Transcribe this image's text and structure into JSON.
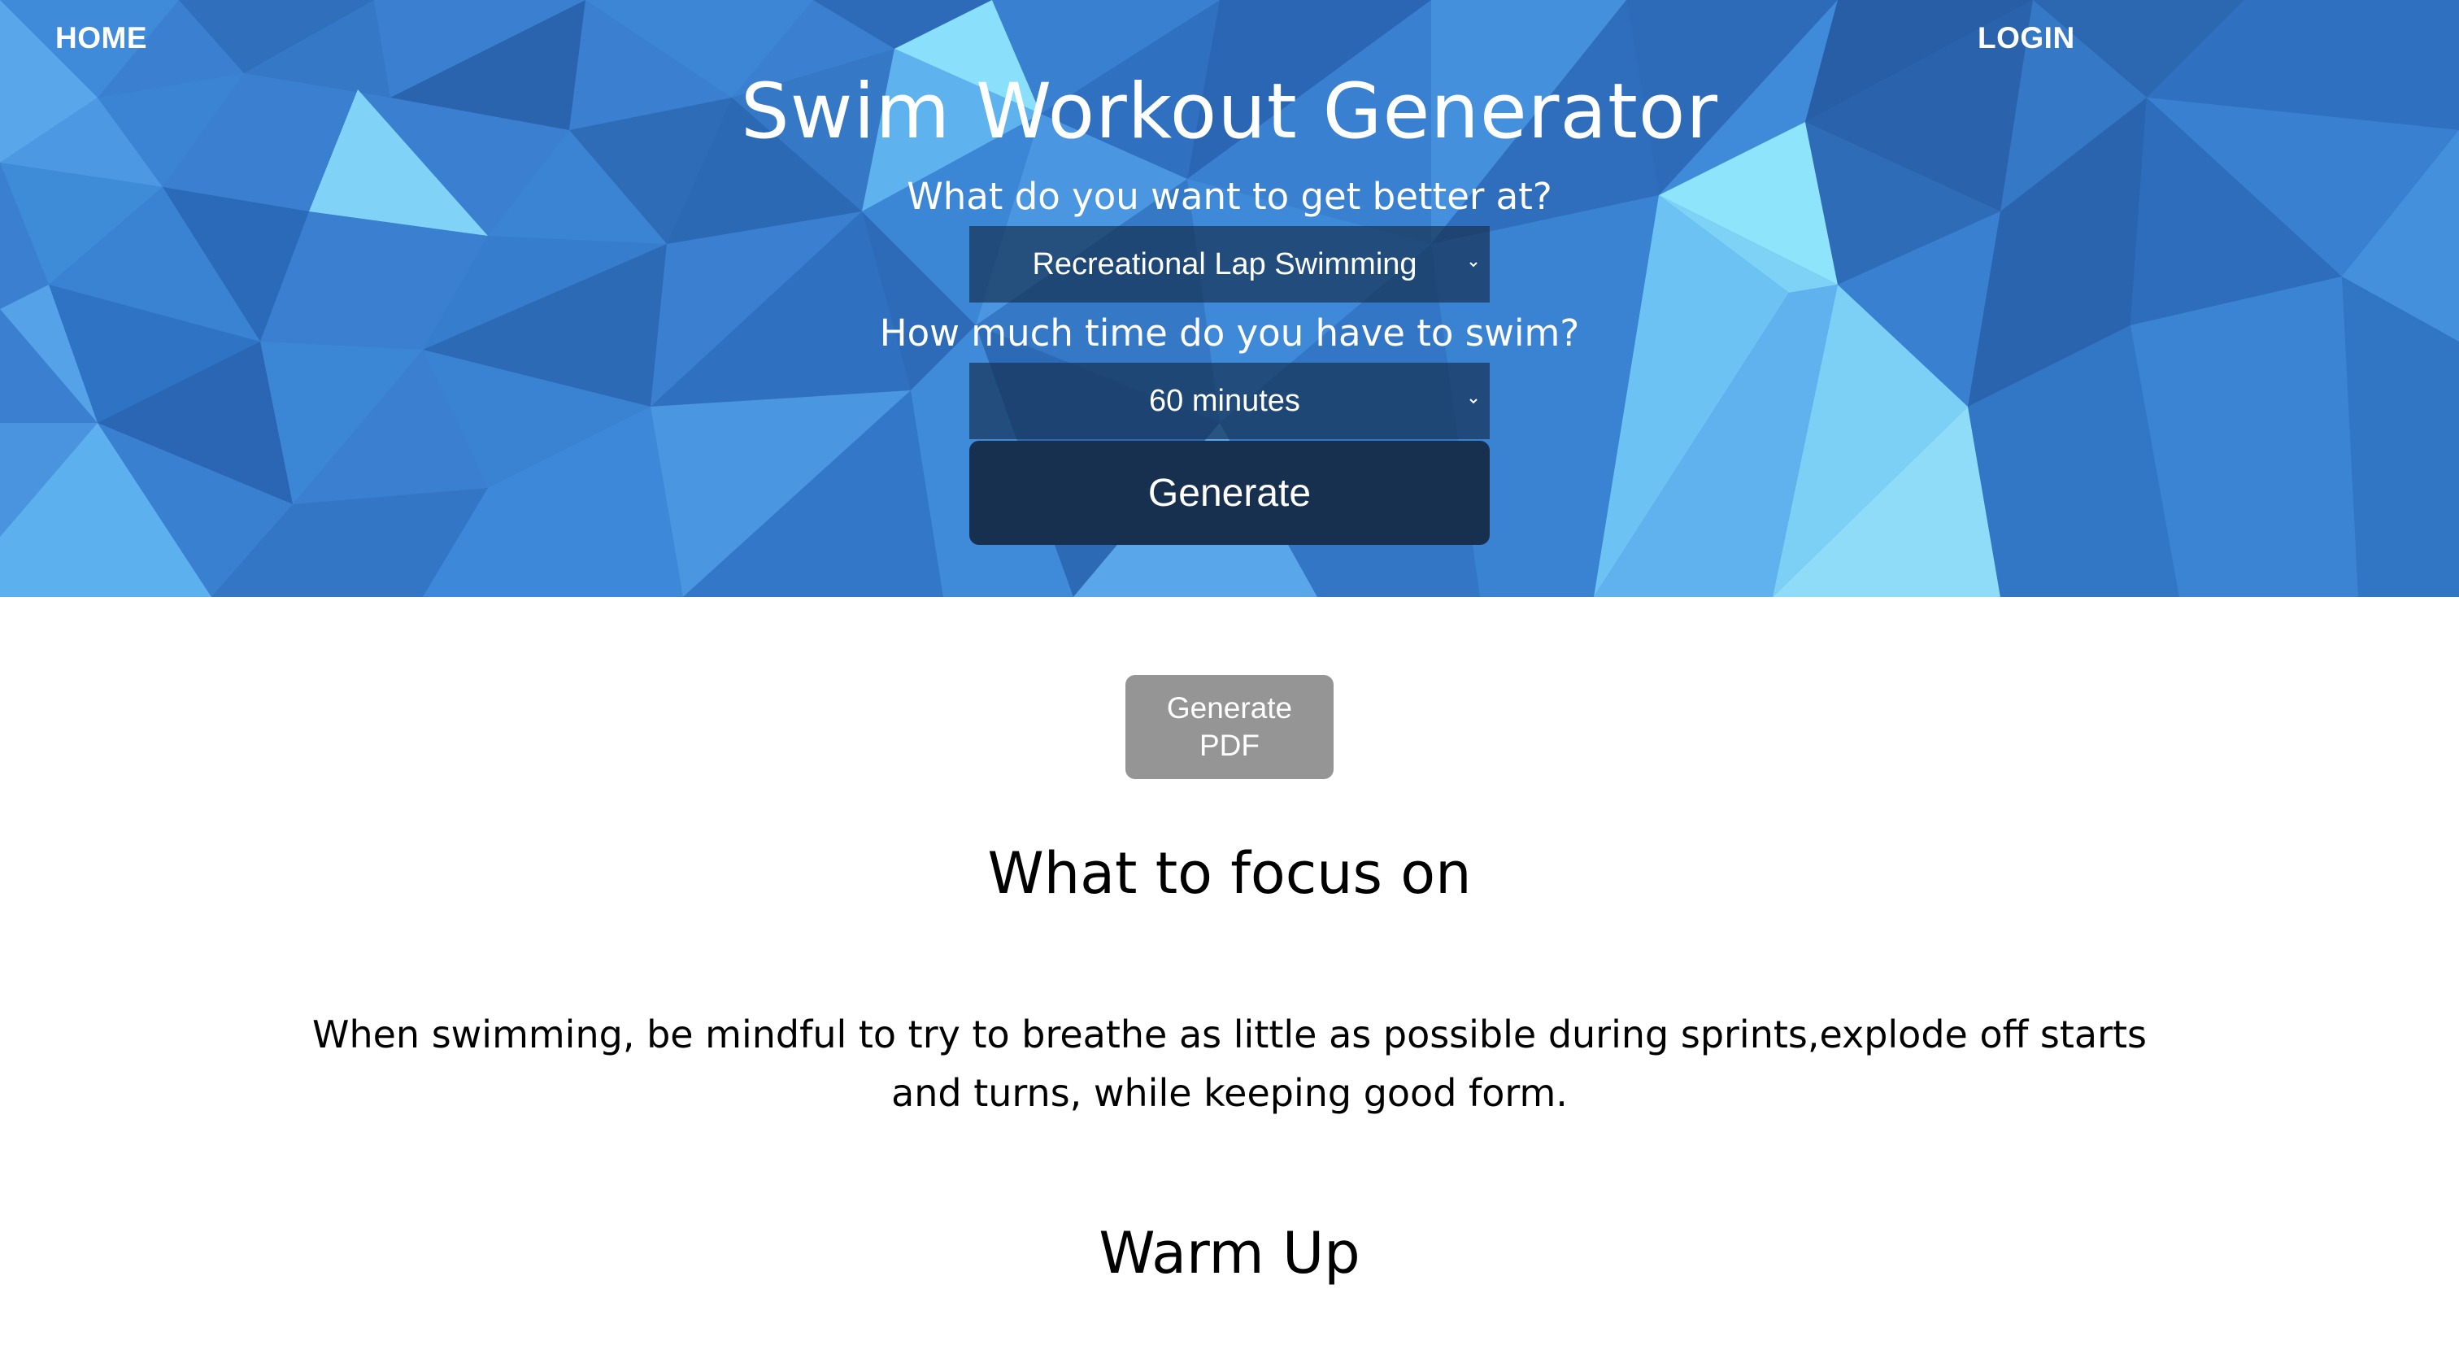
{
  "nav": {
    "home_label": "HOME",
    "login_label": "LOGIN"
  },
  "hero": {
    "title": "Swim Workout Generator",
    "question_goal": "What do you want to get better at?",
    "goal_select_value": "Recreational Lap Swimming",
    "question_time": "How much time do you have to swim?",
    "time_select_value": "60 minutes",
    "generate_label": "Generate"
  },
  "content": {
    "pdf_button_label": "Generate PDF",
    "focus_heading": "What to focus on",
    "focus_text": "When swimming, be mindful to try to breathe as little as possible during sprints,explode off starts and turns, while keeping good form.",
    "warmup_heading": "Warm Up"
  },
  "icons": {
    "select_arrow": "chevron-down-icon"
  },
  "colors": {
    "hero_base": "#3a7fd0",
    "select_bg": "#1f3d63",
    "generate_bg": "#17304f",
    "pdf_button_bg": "#959595",
    "text_dark": "#000000",
    "text_light": "#ffffff"
  }
}
